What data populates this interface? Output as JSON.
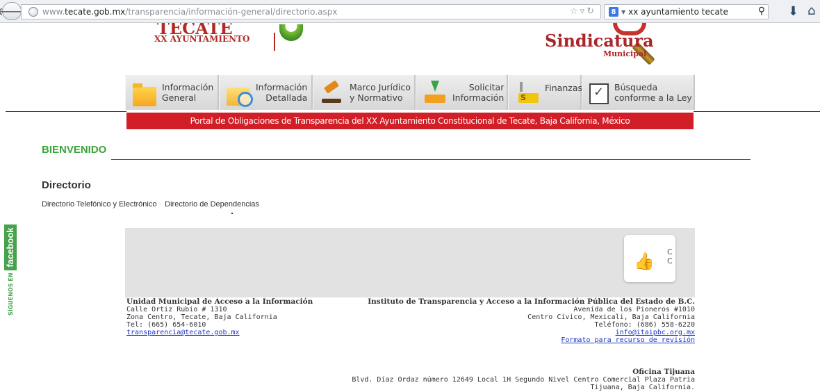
{
  "browser": {
    "url_prefix": "www.",
    "url_host": "tecate.gob.mx",
    "url_path": "/transparencia/información-general/directorio.aspx",
    "search_engine_badge": "8",
    "search_query": "xx ayuntamiento tecate"
  },
  "header": {
    "logo_title": "TECATE",
    "logo_subtitle": "XX AYUNTAMIENTO",
    "sindicatura": "Sindicatura",
    "municipal": "Municipal"
  },
  "nav": [
    {
      "line1": "Información",
      "line2": "General",
      "icon": "folder-icon"
    },
    {
      "line1": "Información",
      "line2": "Detallada",
      "icon": "folder-search-icon"
    },
    {
      "line1": "Marco Jurídico",
      "line2": "y Normativo",
      "icon": "gavel-icon"
    },
    {
      "line1": "Solicitar",
      "line2": "Información",
      "icon": "download-icon"
    },
    {
      "line1": "Finanzas",
      "line2": "",
      "icon": "money-icon"
    },
    {
      "line1": "Búsqueda",
      "line2": "conforme a la Ley",
      "icon": "checklist-icon"
    }
  ],
  "banner_text": "Portal de Obligaciones de Transparencia del XX Ayuntamiento Constitucional de Tecate, Baja California, México",
  "content": {
    "welcome": "BIENVENIDO",
    "section_title": "Directorio",
    "link1": "Directorio Telefónico y Electrónico",
    "link2": "Directorio de Dependencias"
  },
  "facebook": {
    "small": "SÍGUENOS EN",
    "big": "facebook"
  },
  "thumb_card": {
    "line1": "C",
    "line2": "C"
  },
  "footer": {
    "left": {
      "title": "Unidad Municipal de Acceso a la Información",
      "line1": "Calle Ortiz Rubio # 1310",
      "line2": "Zona Centro, Tecate, Baja California",
      "line3": "Tel: (665) 654-6010",
      "email": "transparencia@tecate.gob.mx"
    },
    "right": {
      "title": "Instituto de Transparencia y Acceso a la Información Pública del Estado de B.C.",
      "line1": "Avenida de los Pioneros #1010",
      "line2": "Centro Cívico, Mexicali, Baja California",
      "line3": "Teléfono: (686) 558-6220",
      "email": "info@itaipbc.org.mx",
      "form_link": "Formato para recurso de revisión"
    },
    "tijuana": {
      "title": "Oficina Tijuana",
      "line1": "Blvd. Díaz Ordaz número 12649 Local 1H Segundo Nivel Centro Comercial Plaza Patria",
      "line2": "Tijuana, Baja California."
    }
  }
}
